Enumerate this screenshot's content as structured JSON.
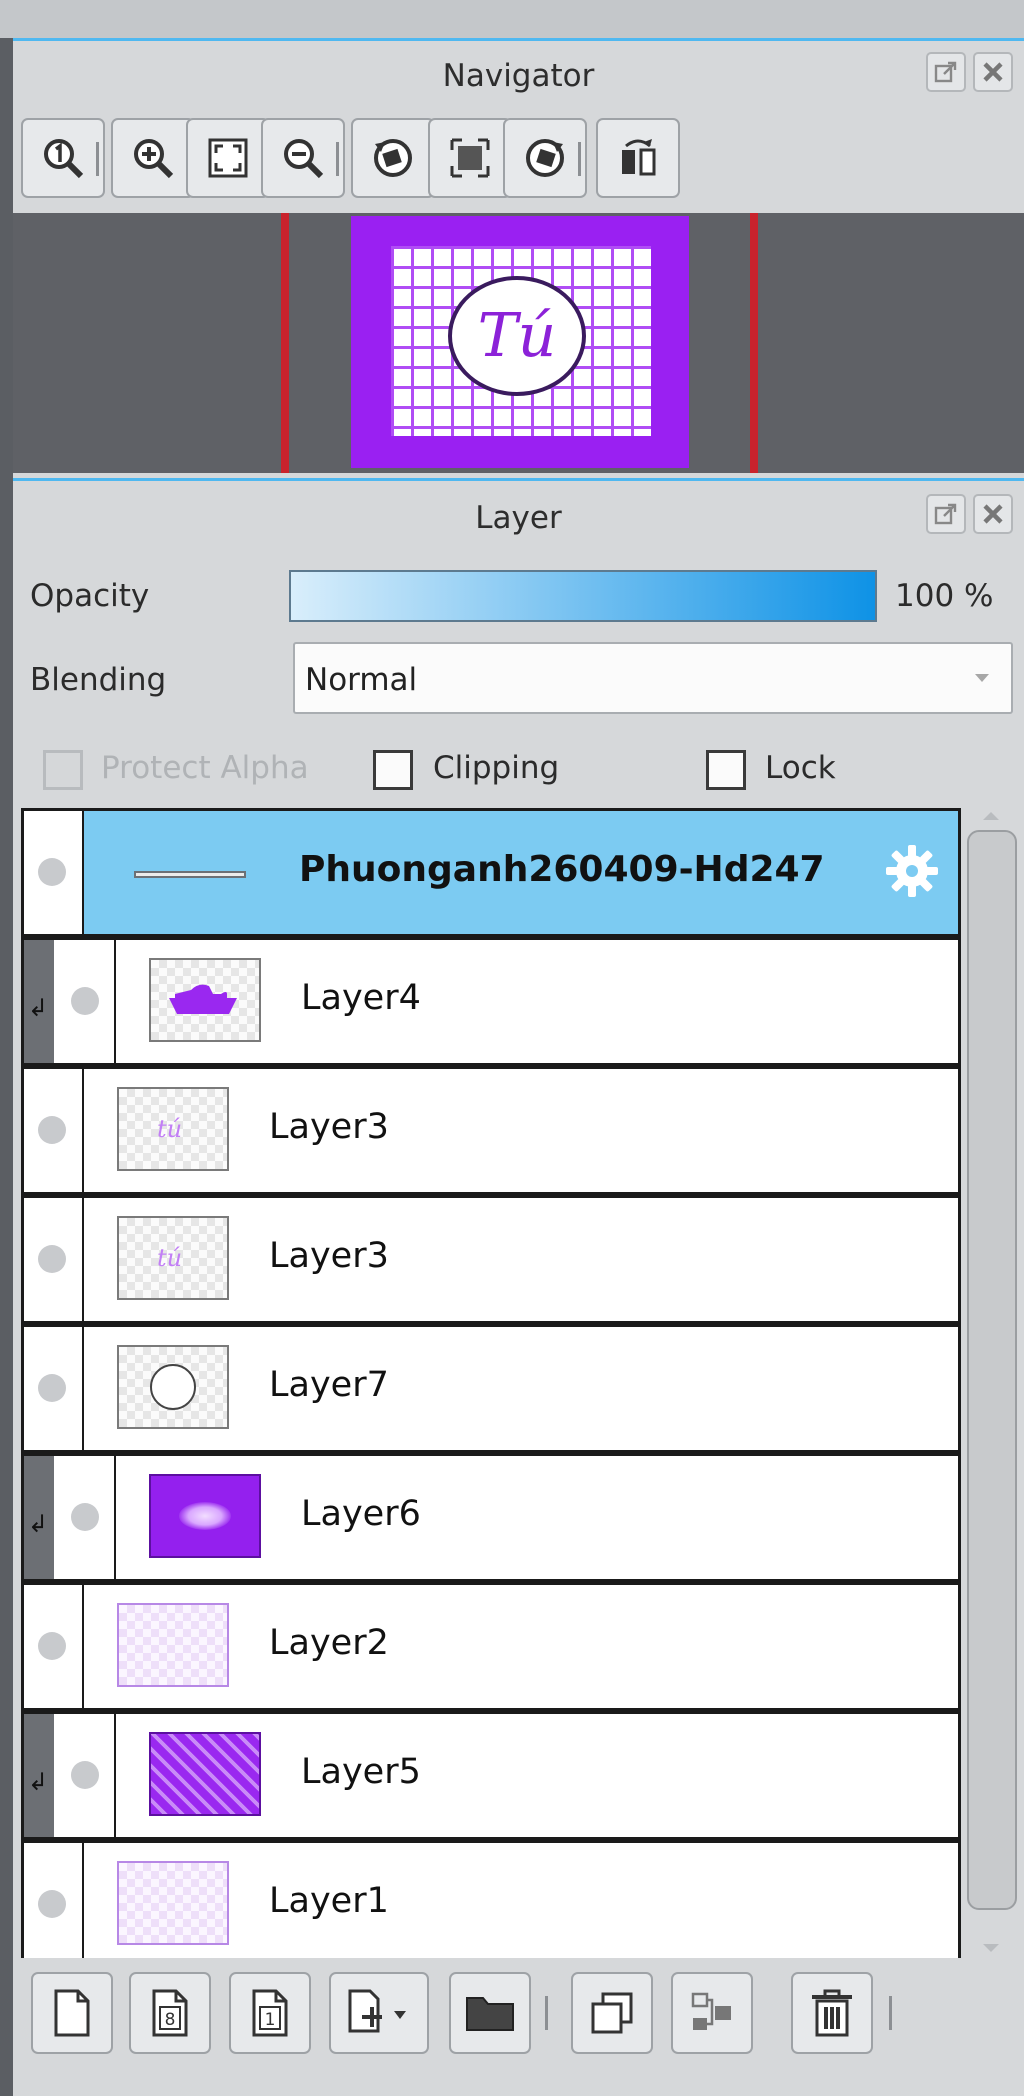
{
  "navigator": {
    "title": "Navigator",
    "toolbar": [
      {
        "name": "zoom-actual-button",
        "icon": "zoom-actual-icon"
      },
      {
        "name": "zoom-in-button",
        "icon": "zoom-in-icon"
      },
      {
        "name": "fit-window-button",
        "icon": "fit-window-icon"
      },
      {
        "name": "zoom-out-button",
        "icon": "zoom-out-icon"
      },
      {
        "name": "rotate-left-button",
        "icon": "rotate-left-icon"
      },
      {
        "name": "reset-view-button",
        "icon": "reset-view-icon"
      },
      {
        "name": "rotate-right-button",
        "icon": "rotate-right-icon"
      },
      {
        "name": "flip-horizontal-button",
        "icon": "flip-horizontal-icon"
      }
    ],
    "preview": {
      "monogram": "Tú",
      "background_color": "#9a20f2"
    }
  },
  "layer_panel": {
    "title": "Layer",
    "opacity_label": "Opacity",
    "opacity_value": "100 %",
    "opacity_fraction": 1.0,
    "blending_label": "Blending",
    "blending_value": "Normal",
    "protect_alpha_label": "Protect Alpha",
    "clipping_label": "Clipping",
    "lock_label": "Lock",
    "layers": [
      {
        "name": "Phuonganh260409-Hd247",
        "kind": "folder",
        "selected": true,
        "clipped": false
      },
      {
        "name": "Layer4",
        "kind": "boat",
        "selected": false,
        "clipped": true
      },
      {
        "name": "Layer3",
        "kind": "text",
        "selected": false,
        "clipped": false
      },
      {
        "name": "Layer3",
        "kind": "text",
        "selected": false,
        "clipped": false
      },
      {
        "name": "Layer7",
        "kind": "circle",
        "selected": false,
        "clipped": false
      },
      {
        "name": "Layer6",
        "kind": "purple",
        "selected": false,
        "clipped": true
      },
      {
        "name": "Layer2",
        "kind": "lilac",
        "selected": false,
        "clipped": false
      },
      {
        "name": "Layer5",
        "kind": "stripes",
        "selected": false,
        "clipped": true
      },
      {
        "name": "Layer1",
        "kind": "lilac",
        "selected": false,
        "clipped": false
      }
    ],
    "bottom_toolbar": [
      {
        "name": "new-layer-button",
        "icon": "new-page-icon",
        "glyph": ""
      },
      {
        "name": "new-8bit-layer-button",
        "icon": "new-8bit-layer-icon",
        "glyph": "8"
      },
      {
        "name": "new-1bit-layer-button",
        "icon": "new-1bit-layer-icon",
        "glyph": "1"
      },
      {
        "name": "add-layer-menu-button",
        "icon": "add-layer-icon",
        "glyph": ""
      },
      {
        "name": "new-folder-button",
        "icon": "folder-icon",
        "glyph": ""
      },
      {
        "name": "duplicate-layer-button",
        "icon": "duplicate-icon",
        "glyph": ""
      },
      {
        "name": "merge-down-button",
        "icon": "merge-down-icon",
        "glyph": ""
      },
      {
        "name": "delete-layer-button",
        "icon": "trash-icon",
        "glyph": ""
      }
    ]
  }
}
